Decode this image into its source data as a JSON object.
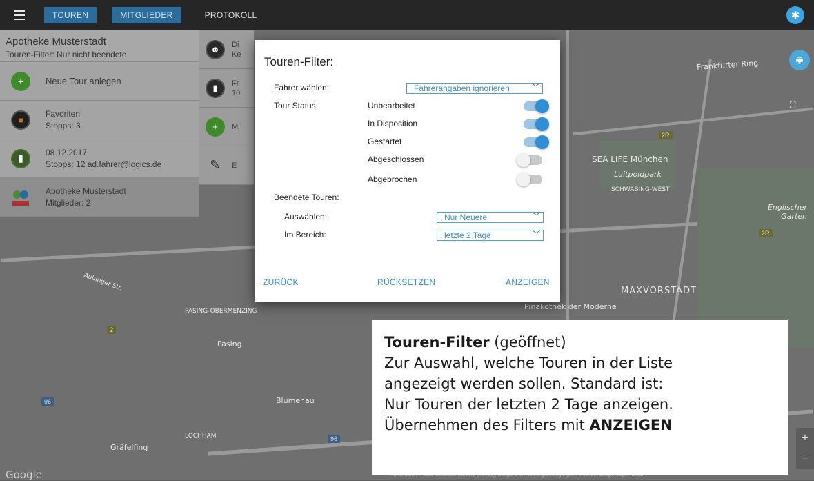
{
  "topbar": {
    "tabs": [
      {
        "label": "TOUREN",
        "active": true
      },
      {
        "label": "MITGLIEDER",
        "active": true
      },
      {
        "label": "PROTOKOLL",
        "active": false
      }
    ],
    "settings_icon": "gear-icon"
  },
  "left_panel": {
    "header_title": "Apotheke Musterstadt",
    "header_subtitle": "Touren-Filter: Nur nicht beendete",
    "new_tour_label": "Neue Tour anlegen",
    "items": [
      {
        "line1": "Favoriten",
        "line2": "Stopps: 3",
        "icon": "favorites-icon"
      },
      {
        "line1": "08.12.2017",
        "line2": "Stopps: 12 ad.fahrer@logics.de",
        "icon": "truck-icon"
      },
      {
        "line1": "Apotheke Musterstadt",
        "line2": "Mitglieder: 2",
        "icon": "pharmacy-logo-icon"
      }
    ]
  },
  "mid_panel": {
    "items": [
      {
        "line1": "Di",
        "line2": "Ke",
        "icon": "group-icon"
      },
      {
        "line1": "Fr",
        "line2": "10",
        "icon": "truck-icon"
      },
      {
        "line1": "Mi",
        "line2": "",
        "icon": "add-icon"
      },
      {
        "line1": "E",
        "line2": "",
        "icon": "pencil-icon"
      }
    ]
  },
  "dialog": {
    "title": "Touren-Filter:",
    "driver_label": "Fahrer wählen:",
    "driver_value": "Fahrerangaben ignorieren",
    "status_label": "Tour Status:",
    "statuses": [
      {
        "label": "Unbearbeitet",
        "on": true
      },
      {
        "label": "In Disposition",
        "on": true
      },
      {
        "label": "Gestartet",
        "on": true
      },
      {
        "label": "Abgeschlossen",
        "on": false
      },
      {
        "label": "Abgebrochen",
        "on": false
      }
    ],
    "finished_label": "Beendete Touren:",
    "select_label": "Auswählen:",
    "select_value": "Nur Neuere",
    "range_label": "Im Bereich:",
    "range_value": "letzte 2 Tage",
    "buttons": {
      "back": "ZURÜCK",
      "reset": "RÜCKSETZEN",
      "show": "ANZEIGEN"
    }
  },
  "callout": {
    "title": "Touren-Filter",
    "title_suffix": " (geöffnet)",
    "line1": "Zur Auswahl, welche Touren in der Liste",
    "line2": "angezeigt werden sollen. Standard ist:",
    "line3": "Nur Touren der letzten 2 Tage anzeigen.",
    "line4_prefix": "Übernehmen des Filters mit ",
    "line4_bold": "ANZEIGEN"
  },
  "map": {
    "labels": [
      "Frankfurter Ring",
      "SEA LIFE München",
      "Luitpoldpark",
      "SCHWABING-WEST",
      "Englischer Garten",
      "MAXVORSTADT",
      "Pinakothek der Moderne",
      "PASING-OBERMENZING",
      "Pasing",
      "Blumenau",
      "Gräfelfing",
      "LOCHHAM",
      "Aubinger Str."
    ],
    "google": "Google",
    "copyright": "Kartendaten © 2018 GeoBasis-DE/BKG (©2009), Google   1 km            Nutzungsbedingungen   Fehler bei Google Maps melden",
    "zoom_in": "+",
    "zoom_out": "−"
  }
}
